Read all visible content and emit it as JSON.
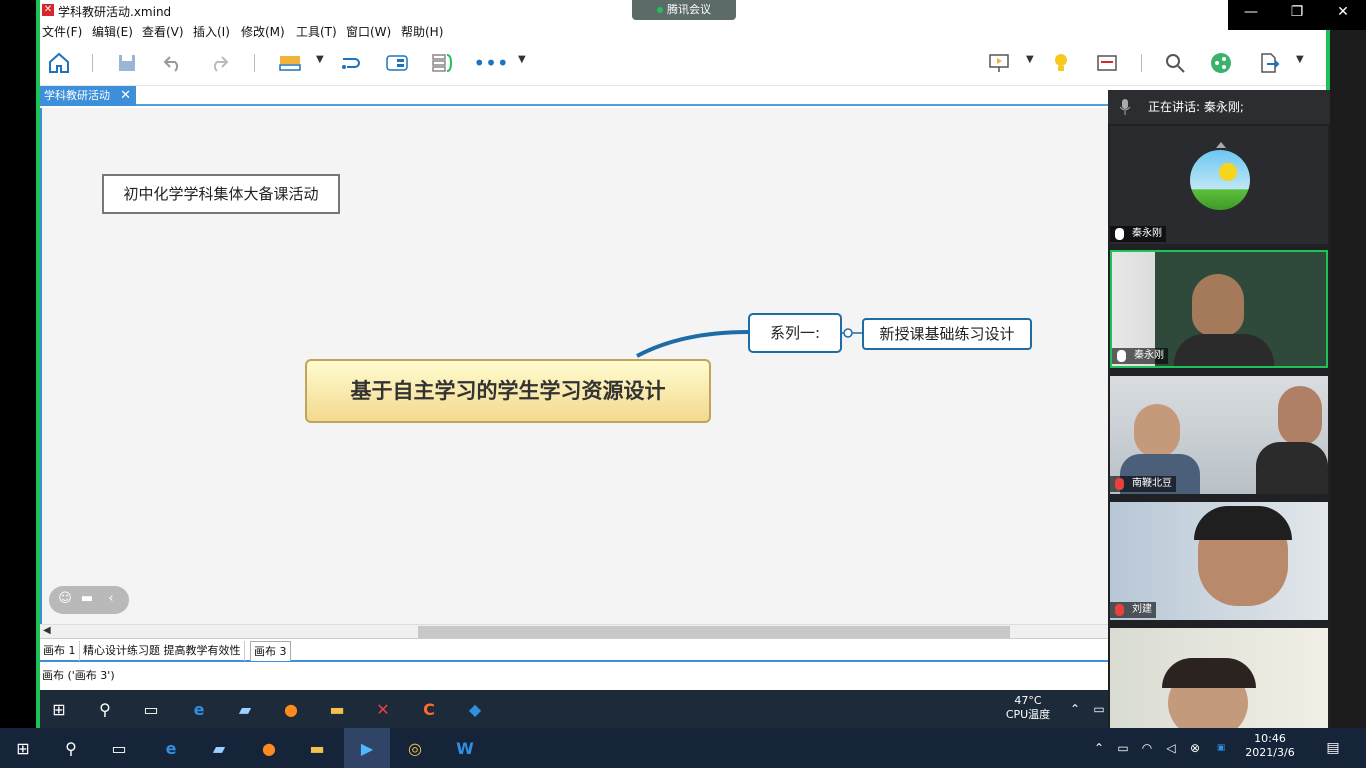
{
  "window": {
    "title": "学科教研活动.xmind",
    "controls": {
      "minimize": "—",
      "restore": "❐",
      "close": "✕"
    }
  },
  "menu": [
    "文件(F)",
    "编辑(E)",
    "查看(V)",
    "插入(I)",
    "修改(M)",
    "工具(T)",
    "窗口(W)",
    "帮助(H)"
  ],
  "meeting_pill": "腾讯会议",
  "doc_tab": {
    "label": "学科教研活动",
    "close": "✕"
  },
  "mindmap": {
    "note": "初中化学学科集体大备课活动",
    "central": "基于自主学习的学生学习资源设计",
    "topic1": "系列一:",
    "topic2": "新授课基础练习设计"
  },
  "sheets": [
    "画布 1",
    "精心设计练习题 提高教学有效性",
    "画布 3"
  ],
  "status": "画布 ('画布 3')",
  "video": {
    "speaking": "正在讲话: 秦永刚;",
    "tiles": [
      {
        "name": "秦永刚"
      },
      {
        "name": "秦永刚"
      },
      {
        "name": "南鞭北豆"
      },
      {
        "name": "刘建"
      },
      {
        "name": ""
      }
    ]
  },
  "inner_tray": {
    "temp": "47°C",
    "cpu": "CPU温度"
  },
  "clock": {
    "time": "10:46",
    "date": "2021/3/6"
  },
  "colors": {
    "accent": "#1ec257",
    "xmind_blue": "#3c8fd8",
    "taskbar": "#16243a"
  }
}
